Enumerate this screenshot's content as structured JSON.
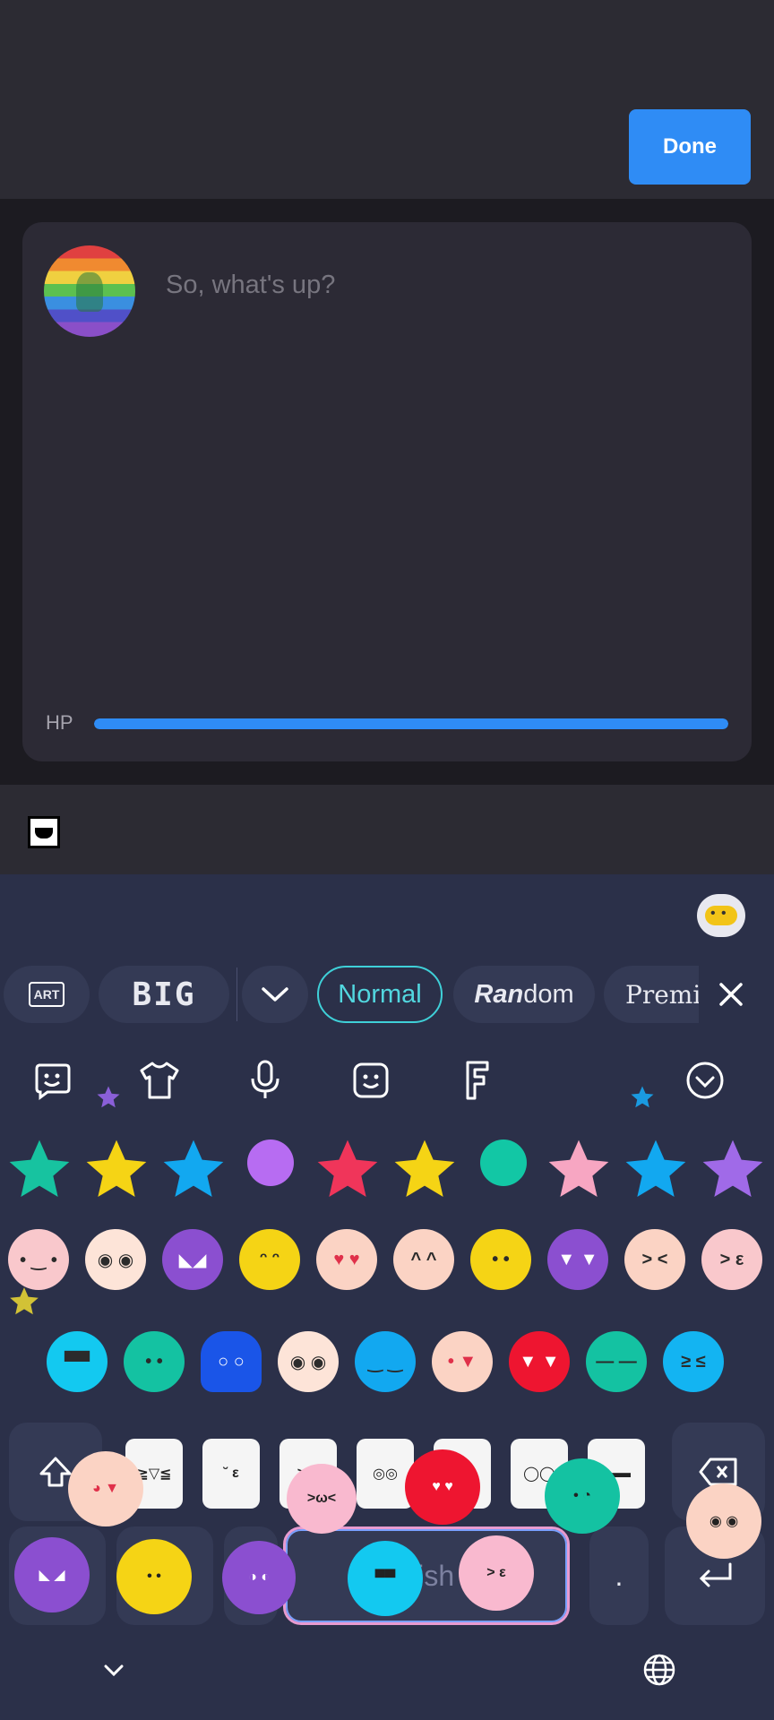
{
  "header": {
    "done_label": "Done"
  },
  "compose": {
    "placeholder": "So, what's up?",
    "hp_label": "HP",
    "hp_level": 1.0
  },
  "keyboard": {
    "toolbar": {
      "art_label": "ART",
      "big_label": "BIG",
      "normal_label": "Normal",
      "random_label_styled": "Ran",
      "random_label_rest": "dom",
      "premium_label": "Premi"
    },
    "icons": [
      "sticker-face-icon",
      "tshirt-icon",
      "microphone-icon",
      "emoji-face-icon",
      "font-icon",
      "chevron-down-circle-icon"
    ],
    "space_label": "English (U",
    "period_label": ".",
    "colors": {
      "accent": "#2f8cf5",
      "normal_chip": "#3fd0d8",
      "keyboard_bg": "#2b3049",
      "key_bg": "#343a55"
    }
  }
}
